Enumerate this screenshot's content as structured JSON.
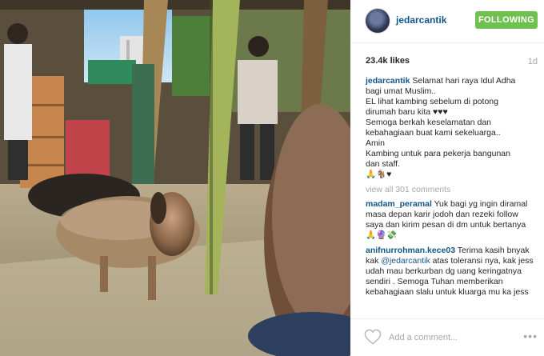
{
  "post": {
    "author": "jedarcantik",
    "follow_label": "FOLLOWING",
    "likes": "23.4k likes",
    "age": "1d",
    "caption": {
      "author": "jedarcantik",
      "first": "Selamat hari raya Idul Adha",
      "lines": [
        "bagi umat Muslim..",
        "EL lihat kambing sebelum di potong",
        "dirumah baru kita ♥♥♥",
        "Semoga berkah keselamatan dan",
        "kebahagiaan buat kami sekeluarga..",
        "Amin",
        "Kambing untuk para pekerja bangunan",
        "dan staff.",
        "🙏🐐♥"
      ]
    },
    "view_all": "view all 301 comments",
    "comments": [
      {
        "author": "madam_peramal",
        "text": "Yuk bagi yg ingin diramal masa depan karir jodoh dan rezeki follow saya dan kirim pesan di dm untuk bertanya 🙏🔮💸"
      },
      {
        "author": "anifnurrohman.kece03",
        "before": "Terima kasih bnyak kak",
        "mention": "@jedarcantik",
        "after": "atas toleransi nya, kak jess udah mau berkurban dg uang keringatnya sendiri . Semoga Tuhan memberikan kebahagiaan slalu untuk kluarga mu ka jess"
      }
    ],
    "add_comment_placeholder": "Add a comment...",
    "more_label": "•••"
  },
  "colors": {
    "link": "#125688",
    "follow_green": "#70c050",
    "muted": "#a5a7aa"
  },
  "icons": {
    "avatar": "profile-photo",
    "like": "heart-outline-icon",
    "more": "more-options-icon"
  }
}
